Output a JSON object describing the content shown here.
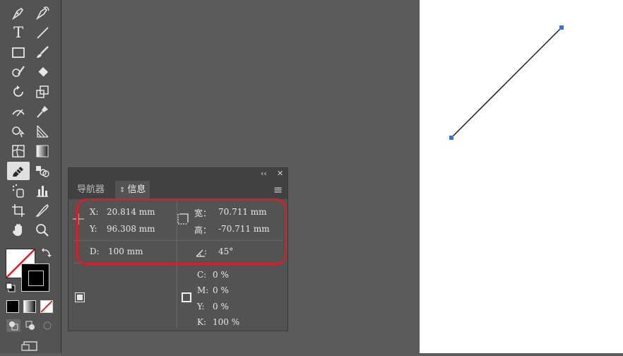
{
  "toolbar": {
    "tools": [
      {
        "name": "pen-tool-icon"
      },
      {
        "name": "curvature-tool-icon"
      },
      {
        "name": "type-tool-icon"
      },
      {
        "name": "line-segment-tool-icon"
      },
      {
        "name": "rectangle-tool-icon"
      },
      {
        "name": "paintbrush-tool-icon"
      },
      {
        "name": "shaper-tool-icon"
      },
      {
        "name": "eraser-tool-icon"
      },
      {
        "name": "rotate-tool-icon"
      },
      {
        "name": "scale-tool-icon"
      },
      {
        "name": "width-tool-icon"
      },
      {
        "name": "puppet-warp-tool-icon"
      },
      {
        "name": "shape-builder-tool-icon"
      },
      {
        "name": "perspective-grid-tool-icon"
      },
      {
        "name": "mesh-tool-icon"
      },
      {
        "name": "gradient-tool-icon"
      },
      {
        "name": "eyedropper-tool-icon"
      },
      {
        "name": "blend-tool-icon"
      },
      {
        "name": "symbol-sprayer-tool-icon"
      },
      {
        "name": "column-graph-tool-icon"
      },
      {
        "name": "artboard-tool-icon"
      },
      {
        "name": "slice-tool-icon"
      },
      {
        "name": "hand-tool-icon"
      },
      {
        "name": "zoom-tool-icon"
      }
    ],
    "text_tool_glyph": "T",
    "fill_color": "#ffffff",
    "stroke_color": "#000000"
  },
  "info_panel": {
    "collapse_glyph": "‹‹",
    "close_glyph": "✕",
    "menu_glyph": "≡",
    "tabs": [
      {
        "label": "导航器"
      },
      {
        "label": "信息",
        "prefix": "⇕"
      }
    ],
    "x": {
      "label": "X:",
      "value": "20.814 mm"
    },
    "y": {
      "label": "Y:",
      "value": "96.308 mm"
    },
    "width": {
      "label": "宽：",
      "value": "70.711 mm"
    },
    "height": {
      "label": "高：",
      "value": "-70.711 mm"
    },
    "distance": {
      "label": "D:",
      "value": "100 mm"
    },
    "angle": {
      "label": ":",
      "value": "45°"
    },
    "cmyk": {
      "c": {
        "label": "C:",
        "value": "0 %"
      },
      "m": {
        "label": "M:",
        "value": "0 %"
      },
      "y": {
        "label": "Y:",
        "value": "0 %"
      },
      "k": {
        "label": "K:",
        "value": "100 %"
      }
    }
  },
  "colors": {
    "highlight": "#d4202a",
    "anchor": "#3a6fe0",
    "path": "#1a1a1a"
  }
}
